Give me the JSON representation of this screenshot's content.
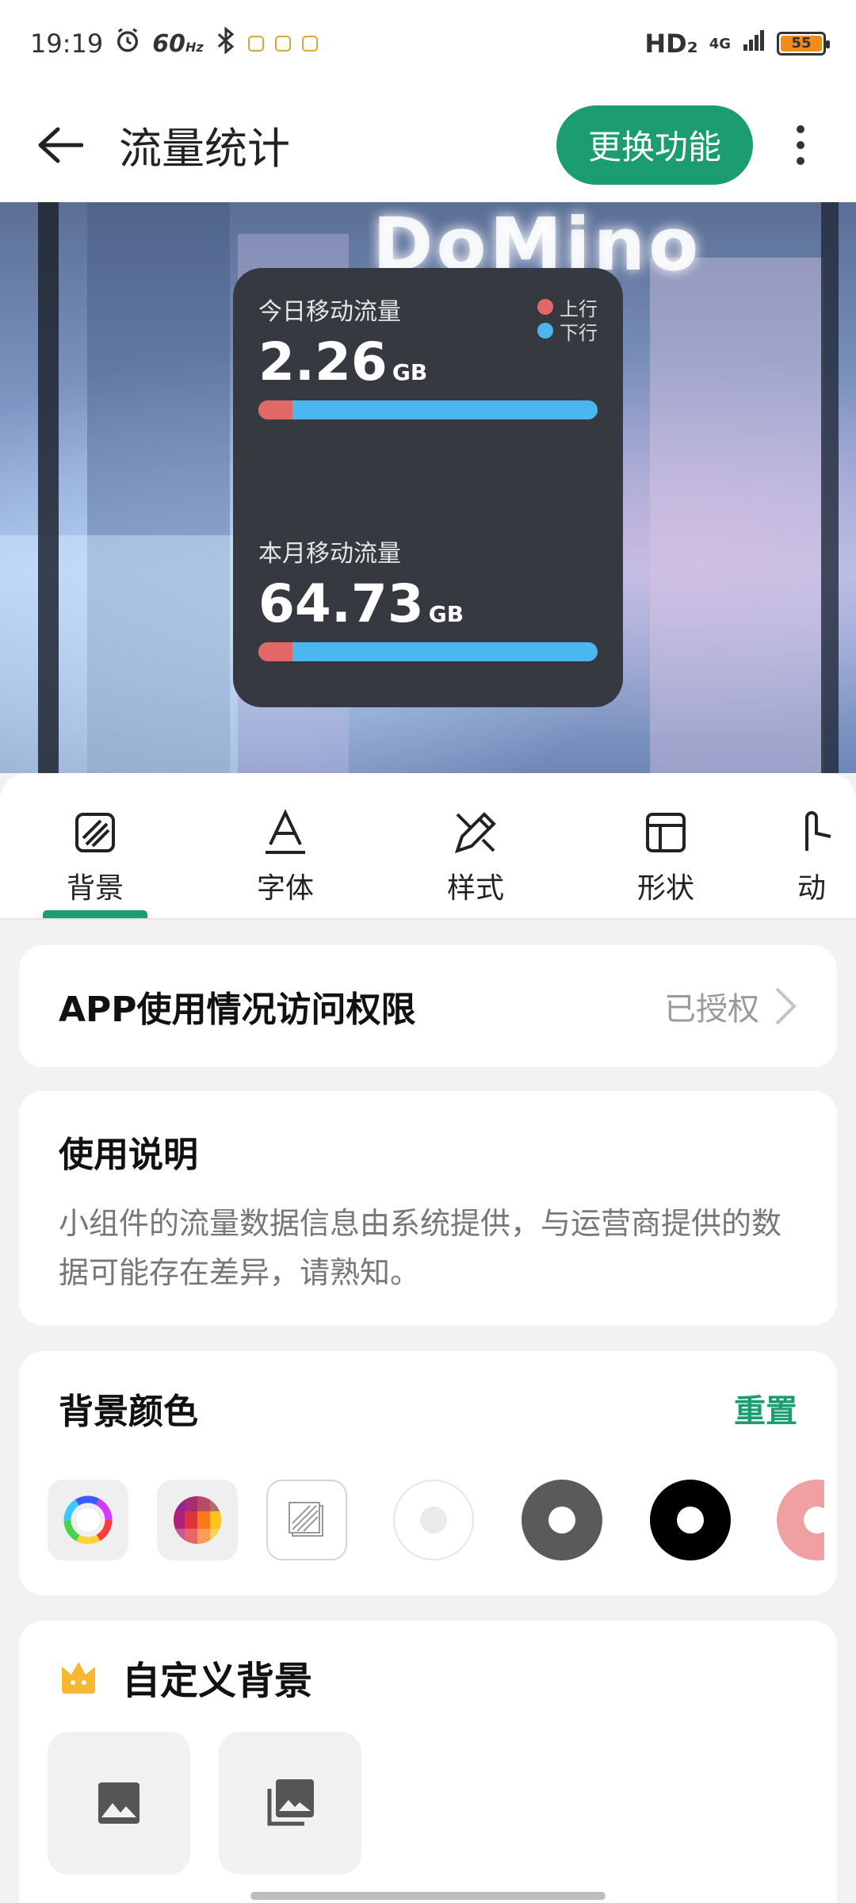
{
  "status_bar": {
    "time": "19:19",
    "refresh_rate": "60",
    "refresh_unit": "Hz",
    "network": "HD₂",
    "signal_type": "4G",
    "battery": "55"
  },
  "toolbar": {
    "title": "流量统计",
    "switch_label": "更换功能"
  },
  "preview": {
    "sign_text": "DoMino",
    "widget": {
      "legend_up": "上行",
      "legend_down": "下行",
      "today_label": "今日移动流量",
      "today_value": "2.26",
      "today_unit": "GB",
      "today_upload_fraction": 0.1,
      "month_label": "本月移动流量",
      "month_value": "64.73",
      "month_unit": "GB",
      "month_upload_fraction": 0.1,
      "colors": {
        "up": "#e26868",
        "down": "#4cb7ee",
        "card": "#36393f"
      }
    }
  },
  "tabs": [
    {
      "label": "背景",
      "icon": "background-pattern-icon",
      "selected": true
    },
    {
      "label": "字体",
      "icon": "font-icon"
    },
    {
      "label": "样式",
      "icon": "style-icon"
    },
    {
      "label": "形状",
      "icon": "shape-icon"
    },
    {
      "label": "动",
      "icon": "animation-icon"
    }
  ],
  "permission": {
    "title": "APP使用情况访问权限",
    "status": "已授权"
  },
  "usage": {
    "title": "使用说明",
    "text": "小组件的流量数据信息由系统提供，与运营商提供的数据可能存在差异，请熟知。"
  },
  "background_color": {
    "title": "背景颜色",
    "reset_label": "重置",
    "swatches": [
      "color-wheel",
      "color-palette",
      "transparent-pattern",
      "#ffffff",
      "#5a5a5a",
      "#000000",
      "#f0a0a0"
    ]
  },
  "custom_background": {
    "title": "自定义背景",
    "options": [
      "image-icon",
      "gallery-icon"
    ]
  },
  "accent_color": "#1b9d6f"
}
